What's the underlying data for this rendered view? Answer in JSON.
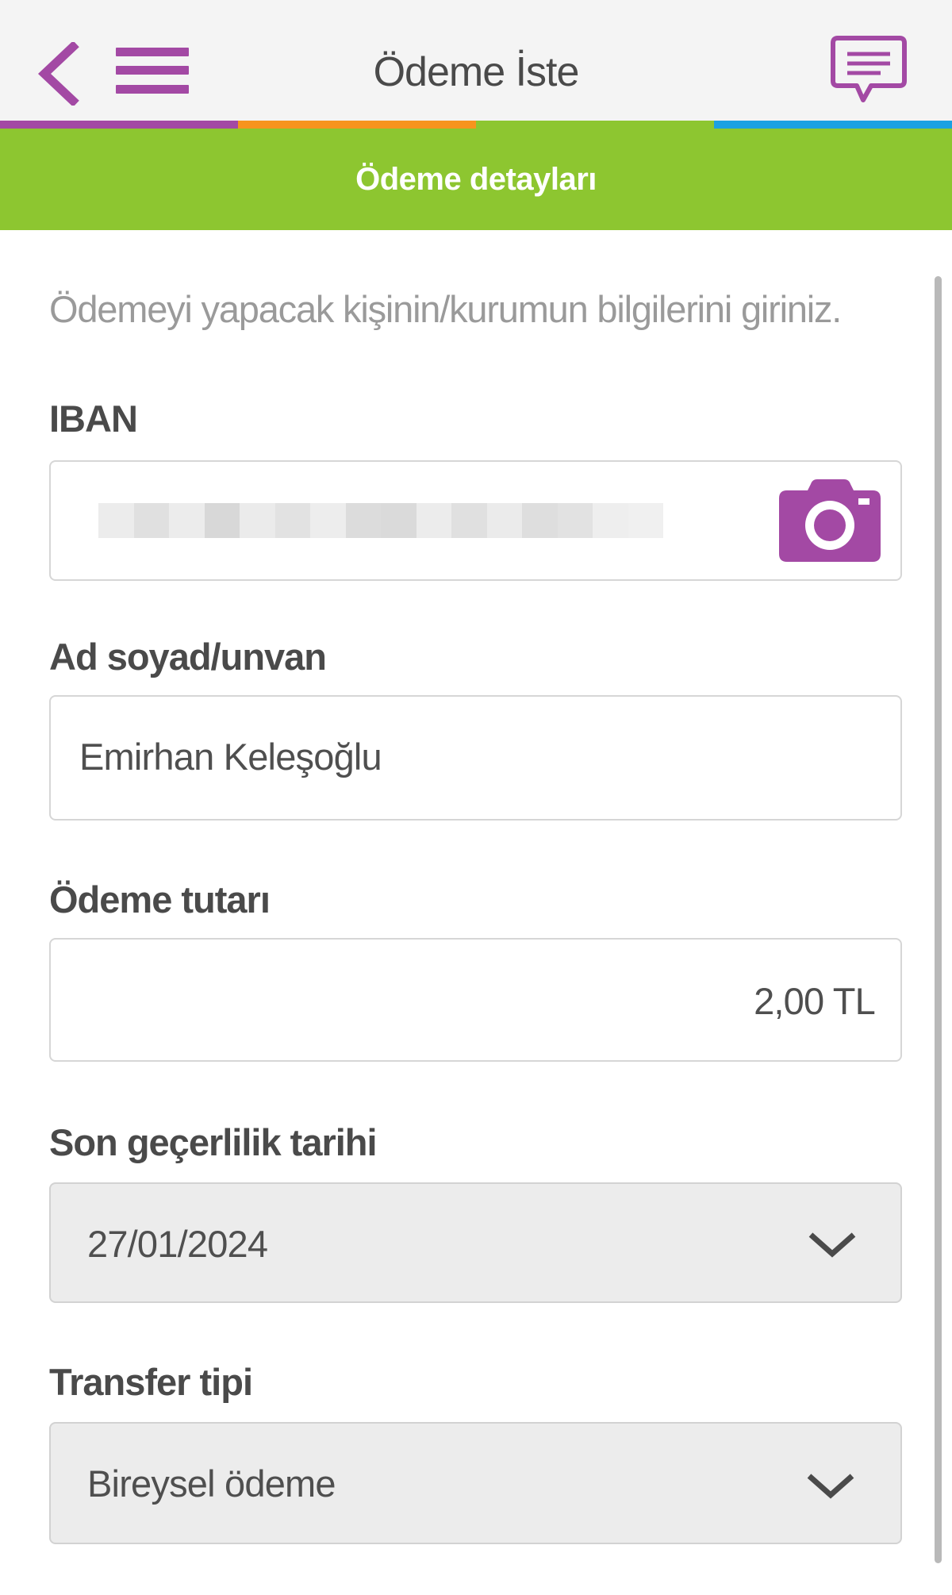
{
  "header": {
    "title": "Ödeme İste",
    "accent_color": "#a349a4",
    "strip_colors": [
      "#a349a4",
      "#f7941d",
      "#8dc630",
      "#1ba1e2"
    ]
  },
  "section": {
    "title": "Ödeme detayları",
    "color": "#8dc630"
  },
  "form": {
    "intro": "Ödemeyi yapacak kişinin/kurumun bilgilerini giriniz.",
    "iban": {
      "label": "IBAN",
      "value": ""
    },
    "name": {
      "label": "Ad soyad/unvan",
      "value": "Emirhan Keleşoğlu"
    },
    "amount": {
      "label": "Ödeme tutarı",
      "value": "2,00 TL"
    },
    "expiry": {
      "label": "Son geçerlilik tarihi",
      "value": "27/01/2024"
    },
    "transfer_type": {
      "label": "Transfer tipi",
      "value": "Bireysel ödeme"
    }
  },
  "icons": {
    "back": "chevron-left-icon",
    "menu": "hamburger-menu-icon",
    "chat": "chat-bubble-icon",
    "camera": "camera-icon",
    "dropdown": "chevron-down-icon"
  }
}
